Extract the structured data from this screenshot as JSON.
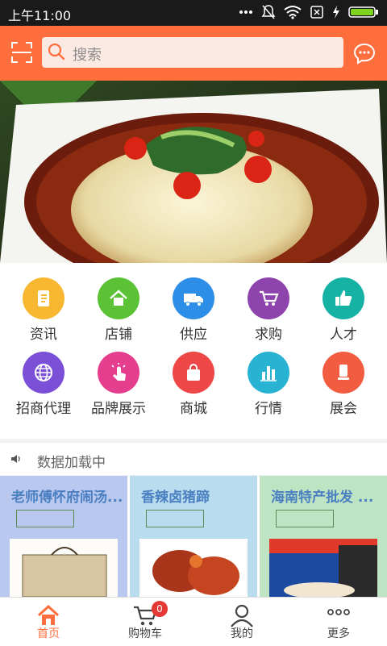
{
  "status_bar": {
    "time": "上午11:00"
  },
  "header": {
    "search_placeholder": "搜索"
  },
  "categories": [
    {
      "label": "资讯",
      "color": "#f7b731",
      "icon": "document-icon"
    },
    {
      "label": "店铺",
      "color": "#5bc236",
      "icon": "house-icon"
    },
    {
      "label": "供应",
      "color": "#2d8ee8",
      "icon": "truck-icon"
    },
    {
      "label": "求购",
      "color": "#8e44ad",
      "icon": "cart-icon"
    },
    {
      "label": "人才",
      "color": "#16b2a4",
      "icon": "thumbs-up-icon"
    },
    {
      "label": "招商代理",
      "color": "#7b4fd6",
      "icon": "globe-icon"
    },
    {
      "label": "品牌展示",
      "color": "#e53e8e",
      "icon": "tap-icon"
    },
    {
      "label": "商城",
      "color": "#ee4747",
      "icon": "bag-icon"
    },
    {
      "label": "行情",
      "color": "#29b3d3",
      "icon": "bar-chart-icon"
    },
    {
      "label": "展会",
      "color": "#f25c41",
      "icon": "phone-icon"
    }
  ],
  "notice": {
    "text": "数据加载中"
  },
  "cards": [
    {
      "title": "老师傅怀府闹汤...",
      "bg": "#b9c8ef"
    },
    {
      "title": "香辣卤猪蹄",
      "bg": "#b9ddef"
    },
    {
      "title": "海南特产批发 ...",
      "bg": "#bfe4c4"
    }
  ],
  "tabbar": {
    "home": "首页",
    "cart": "购物车",
    "cart_badge": "0",
    "mine": "我的",
    "more": "更多",
    "active_color": "#ff6f3d"
  }
}
